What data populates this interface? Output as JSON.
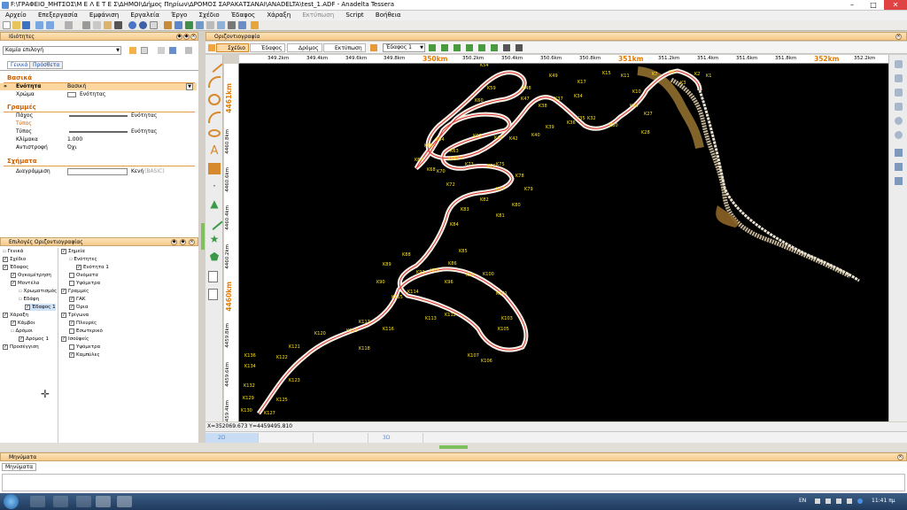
{
  "window": {
    "title": "F:\\ΓΡΑΦΕΙΟ_ΜΗΤΣΟΣ\\Μ Ε Λ Ε Τ Ε Σ\\ΔΗΜΟΙ\\Δήμος Πηρίων\\ΔΡΟΜΟΣ ΣΑΡΑΚΑΤΣΑΝΑΙ\\ANADELTA\\test_1.ADF - Anadelta Tessera"
  },
  "menu": {
    "items": [
      "Αρχείο",
      "Επεξεργασία",
      "Εμφάνιση",
      "Εργαλεία",
      "Έργο",
      "Σχέδιο",
      "Έδαφος",
      "Χάραξη",
      "Εκτύπωση",
      "Script",
      "Βοήθεια"
    ],
    "disabled_label": "Εκτύπωση"
  },
  "properties": {
    "title": "Ιδιότητες",
    "selection": "Καμία επιλογή",
    "tabs": [
      "Γενικά",
      "Πρόσθετα"
    ],
    "groups": {
      "basic": "Βασικά",
      "lines": "Γραμμές",
      "shapes": "Σχήματα"
    },
    "rows": {
      "entity_label": "Ενότητα",
      "entity_value": "Βασική",
      "color_label": "Χρώμα",
      "color_value": "Ενότητας",
      "thickness_label": "Πάχος",
      "thickness_value": "Ενότητας",
      "type_group": "Τύπος",
      "type_label": "Τύπος",
      "type_value": "Ενότητας",
      "scale_label": "Κλίμακα",
      "scale_value": "1.000",
      "reverse_label": "Αντιστροφή",
      "reverse_value": "Όχι",
      "hatch_label": "Διαγράμμιση",
      "hatch_value": "Κενή",
      "hatch_extra": "(BASIC)"
    }
  },
  "layers": {
    "title": "Επιλογές Οριζοντιογραφίας",
    "left_items": [
      "Γενικά",
      "Σχέδιο",
      "Έδαφος",
      "Ογκομέτρηση",
      "Μοντέλα",
      "Χρωματισμός",
      "Εδάφη",
      "Έδαφος 1",
      "Χάραξη",
      "Κάμβοι",
      "Δρόμοι",
      "Δρόμος 1",
      "Προσέγγιση"
    ],
    "right_items": [
      "Σημεία",
      "Ενότητες",
      "Ενότητα 1",
      "Ονόματα",
      "Υψόμετρα",
      "Γραμμές",
      "ΓΑΚ",
      "Όρια",
      "Τρίγωνα",
      "Πλευρές",
      "Εσωτερικό",
      "Ισοϋψείς",
      "Υψόμετρα",
      "Καμπύλες"
    ]
  },
  "view": {
    "title": "Οριζοντιογραφία",
    "tabs": [
      "Σχέδιο",
      "Έδαφος",
      "Δρόμος",
      "Εκτύπωση"
    ],
    "ground_select": "Έδαφος 1",
    "hruler": [
      "349.2km",
      "349.4km",
      "349.6km",
      "349.8km",
      "350km",
      "350.2km",
      "350.4km",
      "350.6km",
      "350.8km",
      "351km",
      "351.2km",
      "351.4km",
      "351.6km",
      "351.8km",
      "352km",
      "352.2km"
    ],
    "vruler": [
      "4461km",
      "4460.8km",
      "4460.6km",
      "4460.4km",
      "4460.2km",
      "4460km",
      "4459.8km",
      "4459.6km",
      "4459.4km"
    ],
    "coords": "X=352069.673  Y=4459495.810",
    "profile_tabs": [
      "2D",
      "",
      "",
      "3D"
    ]
  },
  "road_labels": [
    "K1",
    "K2",
    "K3",
    "K4",
    "K5",
    "K6",
    "K7",
    "K8",
    "K9",
    "K10",
    "K11",
    "K12",
    "K13",
    "K14",
    "K15",
    "K16",
    "K17",
    "K18",
    "K19",
    "K20",
    "K21",
    "K22",
    "K23",
    "K24",
    "K25",
    "K26",
    "K27",
    "K28",
    "K29",
    "K30",
    "K31",
    "K32",
    "K33",
    "K34",
    "K35",
    "K36",
    "K37",
    "K38",
    "K39",
    "K40",
    "K41",
    "K42",
    "K43",
    "K44",
    "K45",
    "K46",
    "K47",
    "K48",
    "K49",
    "K50",
    "K51",
    "K52",
    "K53",
    "K54",
    "K55",
    "K56",
    "K57",
    "K58",
    "K59",
    "K60",
    "K61",
    "K62",
    "K63",
    "K64",
    "K65",
    "K66",
    "K67",
    "K68",
    "K69",
    "K70",
    "K71",
    "K72",
    "K73",
    "K74",
    "K75",
    "K76",
    "K77",
    "K78",
    "K79",
    "K80",
    "K81",
    "K82",
    "K83",
    "K84",
    "K85",
    "K86",
    "K87",
    "K88",
    "K89",
    "K90",
    "K91",
    "K92",
    "K93",
    "K94",
    "K95",
    "K96",
    "K97",
    "K98",
    "K99",
    "K100",
    "K101",
    "K102",
    "K103",
    "K104",
    "K105",
    "K106",
    "K107",
    "K108",
    "K109",
    "K110",
    "K111",
    "K112",
    "K113",
    "K114",
    "K115",
    "K116",
    "K117",
    "K118",
    "K119",
    "K120",
    "K121",
    "K122",
    "K123",
    "K124",
    "K125",
    "K126",
    "K127",
    "K128",
    "K129",
    "K130",
    "K131",
    "K132",
    "K133",
    "K134",
    "K135",
    "K136"
  ],
  "messages": {
    "title": "Μηνύματα",
    "tab": "Μηνύματα"
  },
  "taskbar": {
    "lang": "EN",
    "time": "11:41 πμ"
  },
  "colors": {
    "accent": "#f6c98a",
    "road": "#ffffff",
    "labels": "#ffe51a",
    "ruler_major": "#e57a00"
  }
}
